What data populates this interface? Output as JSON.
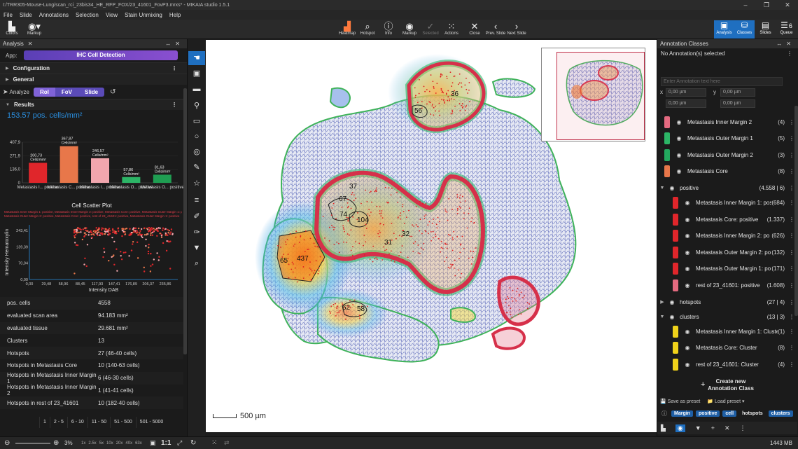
{
  "titlebar": {
    "path": "I:/TRR305-Mouse-Lung/scan_rci_23bis34_HE_RFP_FOX/23_41601_FovP3.mrxs* - MIKAIA studio 1.5.1"
  },
  "menu": [
    "File",
    "Slide",
    "Annotations",
    "Selection",
    "View",
    "Stain Unmixing",
    "Help"
  ],
  "toolbar": {
    "left": [
      {
        "label": "Colors",
        "icon": "chart-icon"
      },
      {
        "label": "Markup",
        "icon": "eye-icon"
      }
    ],
    "center": [
      {
        "label": "Heatmap",
        "icon": "heatmap-icon",
        "dim": false
      },
      {
        "label": "Hotspot",
        "icon": "search-icon",
        "dim": false
      },
      {
        "label": "Info",
        "icon": "info-icon",
        "dim": false
      },
      {
        "label": "Markup",
        "icon": "markup-icon",
        "dim": false
      },
      {
        "label": "Selected",
        "icon": "check-icon",
        "dim": true
      },
      {
        "label": "Actions",
        "icon": "grid-icon",
        "dim": false
      },
      {
        "label": "Close",
        "icon": "close-icon",
        "dim": false
      },
      {
        "label": "Prev. Slide",
        "icon": "chevron-left-icon",
        "dim": false
      },
      {
        "label": "Next Slide",
        "icon": "chevron-right-icon",
        "dim": false
      }
    ],
    "right": [
      {
        "label": "Analysis",
        "icon": "analysis-icon",
        "active": true
      },
      {
        "label": "Classes",
        "icon": "classes-icon",
        "active": true
      },
      {
        "label": "Slides",
        "icon": "slides-icon",
        "active": false
      },
      {
        "label": "Queue",
        "icon": "queue-icon",
        "active": false,
        "badge": "6"
      }
    ]
  },
  "analysis": {
    "panel_title": "Analysis",
    "app_label": "App:",
    "app_name": "IHC Cell Detection",
    "configuration": "Configuration",
    "general": "General",
    "analyze_label": "Analyze",
    "analyze_options": [
      "RoI",
      "FoV",
      "Slide"
    ],
    "results": "Results",
    "headline": "153.57 pos. cells/mm²",
    "scatter_title": "Cell Scatter Plot",
    "scatter_legend_1": "Metastasis Inner Margin 1: positive, Metastasis Inner Margin 2: positive, Metastasis Core: positive, Metastasis Outer Margin 1: positive",
    "scatter_legend_2": "Metastasis Outer Margin 2: positive, Metastasis Core: positive, rest of 23_41601: positive, Metastasis Outer Margin 1: positive"
  },
  "chart_data": [
    {
      "type": "bar",
      "categories": [
        "Metastasis I... positive",
        "Metastasis C... positive",
        "Metastasis I... positive",
        "Metastasis O... positive",
        "Metastasis O... positive"
      ],
      "values": [
        200.73,
        367.87,
        246.57,
        57.86,
        81.63
      ],
      "value_labels": [
        "200,73",
        "367,87",
        "246,57",
        "57,86",
        "81,63"
      ],
      "unit_label": "Cells/mm²",
      "colors": [
        "#e0262b",
        "#e8774a",
        "#f2a6ae",
        "#2cb566",
        "#1f9e52"
      ],
      "yticks": [
        "0",
        "136,0",
        "271,9",
        "407,9"
      ],
      "ylim": [
        0,
        407.9
      ]
    },
    {
      "type": "scatter",
      "title": "Cell Scatter Plot",
      "xlabel": "Intensity DAB",
      "ylabel": "Intensity Hematoxylin",
      "xticks": [
        "0,00",
        "29,48",
        "58,96",
        "88,45",
        "117,93",
        "147,41",
        "176,89",
        "206,37",
        "235,86"
      ],
      "yticks": [
        "0,00",
        "70,04",
        "139,39",
        "243,41"
      ],
      "xlim": [
        0,
        255
      ],
      "ylim": [
        0,
        260
      ]
    }
  ],
  "stats": [
    {
      "k": "pos. cells",
      "v": "4558"
    },
    {
      "k": "evaluated scan area",
      "v": "94.183 mm²"
    },
    {
      "k": "evaluated tissue",
      "v": "29.681 mm²"
    },
    {
      "k": "Clusters",
      "v": "13"
    },
    {
      "k": "Hotspots",
      "v": "27 (46-40 cells)"
    },
    {
      "k": "Hotspots in Metastasis Core",
      "v": "10 (140-63 cells)"
    },
    {
      "k": "Hotspots in Metastasis Inner Margin 1",
      "v": "6 (46-30 cells)"
    },
    {
      "k": "Hotspots in Metastasis Inner Margin 2",
      "v": "1 (41-41 cells)"
    },
    {
      "k": "Hotspots in rest of 23_41601",
      "v": "10 (182-40 cells)"
    }
  ],
  "bins": [
    "1",
    "2 - 5",
    "6 - 10",
    "11 - 50",
    "51 - 500",
    "501 - 5000"
  ],
  "viewer": {
    "scale": "500 µm",
    "cluster_labels": [
      "56",
      "36",
      "37",
      "67",
      "74",
      "104",
      "32",
      "31",
      "65",
      "437",
      "62",
      "58"
    ]
  },
  "classes_panel": {
    "title": "Annotation Classes",
    "no_selection": "No Annotation(s) selected",
    "enter_text": "Enter Annotation text here",
    "x_label": "x",
    "y_label": "y",
    "coord_value": "0,00 µm",
    "items": [
      {
        "name": "Metastasis Inner Margin 2",
        "count": "(4)",
        "color": "#e46a80",
        "type": "cls"
      },
      {
        "name": "Metastasis Outer Margin 1",
        "count": "(5)",
        "color": "#2cb566",
        "type": "cls"
      },
      {
        "name": "Metastasis Outer Margin 2",
        "count": "(3)",
        "color": "#23a85e",
        "type": "cls"
      },
      {
        "name": "Metastasis Core",
        "count": "(8)",
        "color": "#e8774a",
        "type": "cls"
      },
      {
        "name": "positive",
        "count": "(4.558 | 6)",
        "type": "grp",
        "expanded": true
      },
      {
        "name": "Metastasis Inner Margin 1: pos",
        "count": "(684)",
        "color": "#e0262b",
        "type": "sub"
      },
      {
        "name": "Metastasis Core: positive",
        "count": "(1.337)",
        "color": "#e0262b",
        "type": "sub"
      },
      {
        "name": "Metastasis Inner Margin 2: po",
        "count": "(626)",
        "color": "#e0262b",
        "type": "sub"
      },
      {
        "name": "Metastasis Outer Margin 2: po",
        "count": "(132)",
        "color": "#e0262b",
        "type": "sub"
      },
      {
        "name": "Metastasis Outer Margin 1: po",
        "count": "(171)",
        "color": "#e0262b",
        "type": "sub"
      },
      {
        "name": "rest of 23_41601: positive",
        "count": "(1.608)",
        "color": "#e46a80",
        "type": "sub"
      },
      {
        "name": "hotspots",
        "count": "(27 | 4)",
        "type": "grp",
        "expanded": false
      },
      {
        "name": "clusters",
        "count": "(13 | 3)",
        "type": "grp",
        "expanded": true
      },
      {
        "name": "Metastasis Inner Margin 1: Cluste",
        "count": "(1)",
        "color": "#f0d21a",
        "type": "sub"
      },
      {
        "name": "Metastasis Core: Cluster",
        "count": "(8)",
        "color": "#f0d21a",
        "type": "sub"
      },
      {
        "name": "rest of 23_41601: Cluster",
        "count": "(4)",
        "color": "#f0d21a",
        "type": "sub"
      }
    ],
    "create_label_1": "Create new",
    "create_label_2": "Annotation Class",
    "save_preset": "Save as preset",
    "load_preset": "Load preset",
    "tags": [
      "Margin",
      "positive",
      "cell",
      "hotspots",
      "clusters"
    ]
  },
  "statusbar": {
    "zoom": "3%",
    "zoom_steps": [
      "1x",
      "2.5x",
      "5x",
      "10x",
      "20x",
      "40x",
      "63x"
    ],
    "ratio": "1:1",
    "memory": "1443 MB"
  }
}
